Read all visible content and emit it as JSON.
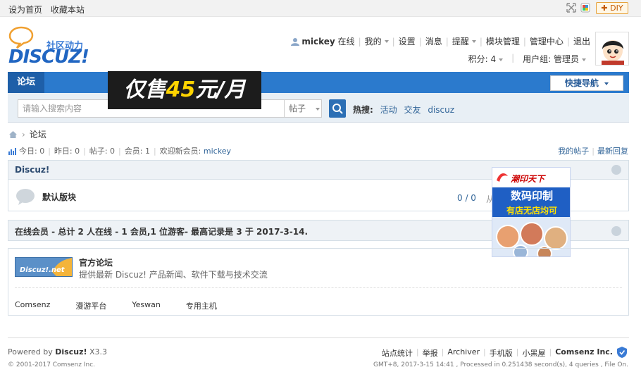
{
  "topbar": {
    "set_home": "设为首页",
    "bookmark": "收藏本站",
    "diy_label": "DIY"
  },
  "logo": {
    "cn_text": "社区动力",
    "en_text": "DISCUZ!"
  },
  "user": {
    "name": "mickey",
    "status": "在线",
    "menu": [
      "我的",
      "设置",
      "消息",
      "提醒",
      "模块管理",
      "管理中心",
      "退出"
    ],
    "credits_label": "积分: 4",
    "group_label": "用户组: 管理员"
  },
  "nav": {
    "forum_tab": "论坛",
    "quick_nav": "快捷导航"
  },
  "promo": {
    "prefix": "仅售",
    "number": "45",
    "suffix": "元/月"
  },
  "search": {
    "placeholder": "请输入搜索内容",
    "type_value": "帖子",
    "hot_label": "热搜:",
    "hot_terms": [
      "活动",
      "交友",
      "discuz"
    ]
  },
  "breadcrumb": {
    "current": "论坛"
  },
  "stats": {
    "today": "今日: 0",
    "yesterday": "昨日: 0",
    "posts": "帖子: 0",
    "members": "会员: 1",
    "welcome": "欢迎新会员:",
    "new_member": "mickey"
  },
  "right_links": {
    "my_posts": "我的帖子",
    "latest_replies": "最新回复"
  },
  "forum_category": {
    "title": "Discuz!",
    "forum_name": "默认版块",
    "counts": "0 / 0",
    "last_post": "从"
  },
  "ad": {
    "brand": "潮印天下",
    "line1": "数码印制",
    "line2": "有店无店均可"
  },
  "online": {
    "text": "在线会员 - 总计 2 人在线 - 1 会员,1 位游客- 最高记录是 3 于 2017-3-14."
  },
  "links": {
    "logo_text": "Discuz!.net",
    "official_title": "官方论坛",
    "official_desc": "提供最新 Discuz! 产品新闻、软件下载与技术交流",
    "partners": [
      "Comsenz",
      "漫游平台",
      "Yeswan",
      "专用主机"
    ]
  },
  "footer": {
    "powered_prefix": "Powered by",
    "powered_brand": "Discuz!",
    "version": "X3.3",
    "copyright": "© 2001-2017 Comsenz Inc.",
    "links": [
      "站点统计",
      "举报",
      "Archiver",
      "手机版",
      "小黑屋"
    ],
    "company": "Comsenz Inc.",
    "gmt": "GMT+8, 2017-3-15 14:41 , Processed in 0.251438 second(s), 4 queries , File On."
  },
  "colors": {
    "nav_blue": "#2b7acd",
    "nav_tab_dark": "#1e5fa8",
    "link_blue": "#336699",
    "promo_yellow": "#ffd400"
  }
}
